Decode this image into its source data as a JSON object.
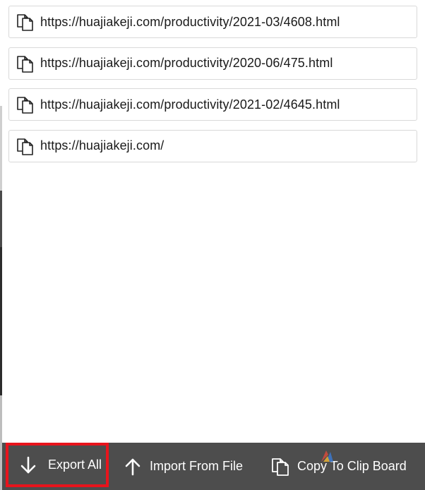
{
  "urls": [
    {
      "text": "https://huajiakeji.com/productivity/2021-03/4608.html",
      "icon": "copy-icon"
    },
    {
      "text": "https://huajiakeji.com/productivity/2020-06/475.html",
      "icon": "copy-icon"
    },
    {
      "text": "https://huajiakeji.com/productivity/2021-02/4645.html",
      "icon": "copy-icon"
    },
    {
      "text": "https://huajiakeji.com/",
      "icon": "copy-icon"
    }
  ],
  "toolbar": {
    "export_label": "Export All",
    "import_label": "Import From File",
    "copy_label": "Copy To Clip Board",
    "export_icon": "arrow-down-icon",
    "import_icon": "arrow-up-icon",
    "copy_icon": "copy-icon"
  },
  "colors": {
    "toolbar_bg": "#4d4d4d",
    "highlight": "#e8141c",
    "item_border": "#d9d9d9"
  }
}
